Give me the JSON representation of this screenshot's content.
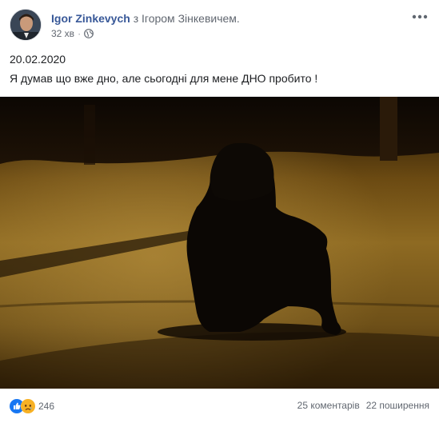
{
  "post": {
    "author": "Igor Zinkevych",
    "with_text": "з Ігором Зінкевичем.",
    "time": "32 хв",
    "privacy_icon": "globe-icon",
    "more_icon": "more-horizontal-icon",
    "date_line": "20.02.2020",
    "message": "Я думав що вже дно, але сьогодні для мене ДНО пробито !",
    "photo_subject": "hooded-figure-sitting-on-road-at-night"
  },
  "footer": {
    "reaction_icons": [
      "like-icon",
      "sad-icon"
    ],
    "reaction_count": "246",
    "comments": "25 коментарів",
    "shares": "22 поширення"
  },
  "colors": {
    "link": "#385898",
    "secondary_text": "#616770",
    "like": "#1877f2",
    "sad": "#f7b125"
  }
}
